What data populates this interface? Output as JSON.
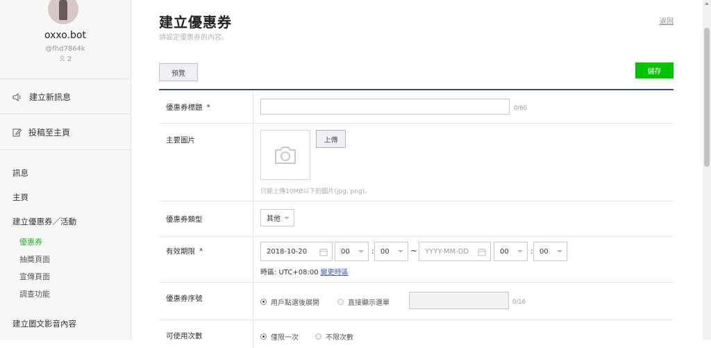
{
  "sidebar": {
    "bot_name": "oxxo.bot",
    "bot_id": "@fhd7864k",
    "friends_count": "2",
    "actions": [
      {
        "label": "建立新訊息",
        "icon": "speaker-icon"
      },
      {
        "label": "投稿至主頁",
        "icon": "edit-icon"
      }
    ],
    "nav": {
      "messages": "訊息",
      "home": "主頁",
      "coupons_events": "建立優惠券／活動",
      "coupon": "優惠券",
      "lottery": "抽獎頁面",
      "promo": "宣傳頁面",
      "survey": "調查功能",
      "rich_content": "建立圖文影音內容"
    }
  },
  "main": {
    "title": "建立優惠券",
    "subtitle": "請設定優惠券的內容。",
    "back_label": "返回",
    "preview_label": "預覽",
    "save_label": "儲存",
    "accent": "#00c300"
  },
  "form": {
    "title_field": {
      "label": "優惠券標題",
      "required_mark": "*",
      "value": "",
      "counter": "0/60"
    },
    "image_field": {
      "label": "主要圖片",
      "upload_label": "上傳",
      "hint": "只能上傳10MB以下的圖片(jpg, png)。"
    },
    "type_field": {
      "label": "優惠券類型",
      "selected": "其他"
    },
    "validity_field": {
      "label": "有效期限",
      "required_mark": "*",
      "start_date": "2018-10-20",
      "start_hour": "00",
      "start_minute": "00",
      "separator": "~",
      "end_date_placeholder": "YYYY-MM-DD",
      "end_hour": "00",
      "end_minute": "00",
      "timezone_text": "時區: UTC+08:00",
      "change_timezone_label": "變更時區"
    },
    "serial_field": {
      "label": "優惠券序號",
      "option_expand": "用戶點選後展開",
      "option_direct": "直接顯示選單",
      "counter": "0/16"
    },
    "usage_field": {
      "label": "可使用次數",
      "option_once": "僅限一次",
      "option_unlimited": "不限次數"
    }
  }
}
